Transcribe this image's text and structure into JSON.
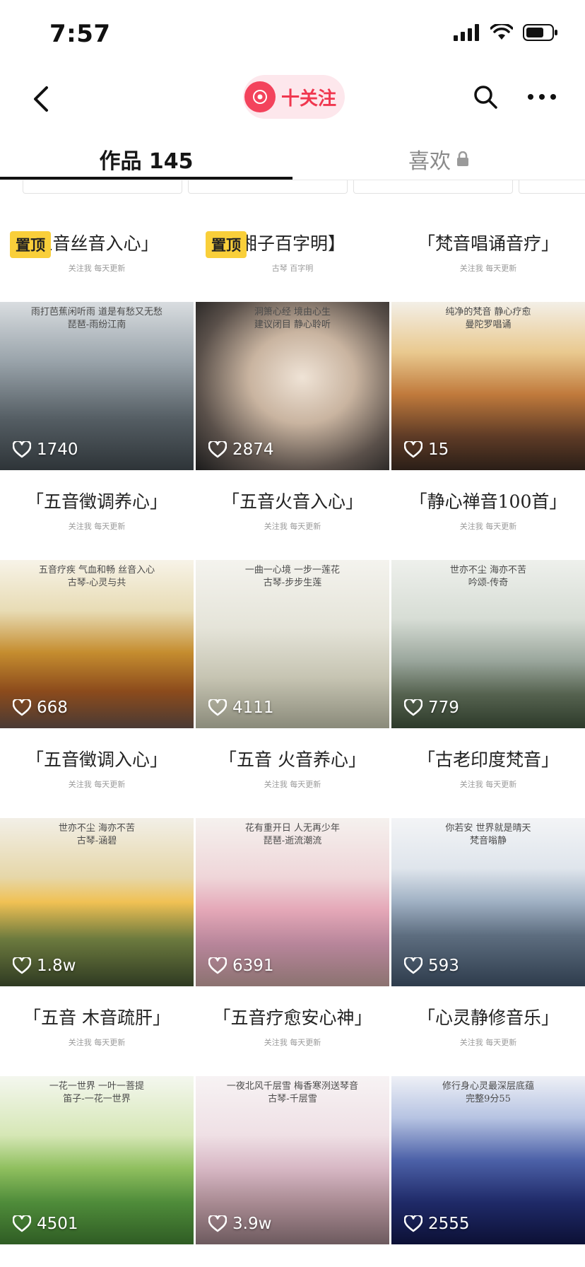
{
  "status_bar": {
    "time": "7:57"
  },
  "nav": {
    "follow_label": "十关注"
  },
  "tabs": [
    {
      "label": "作品 145"
    },
    {
      "label": "喜欢"
    }
  ],
  "pin_label": "置顶",
  "videos": [
    {
      "title": "五音丝音入心」",
      "meta": "关注我 每天更新",
      "caption": "雨打芭蕉闲听雨 道是有愁又无愁\n琵琶-雨纷江南",
      "likes": "1740",
      "pinned": true,
      "scene": "pavilion-rain"
    },
    {
      "title": "湘子百字明】",
      "meta": "古琴 百字明",
      "caption": "洞箫心经 境由心生\n建议闭目 静心聆听",
      "likes": "2874",
      "pinned": true,
      "scene": "singer"
    },
    {
      "title": "「梵音唱诵音疗」",
      "meta": "关注我 每天更新",
      "caption": "纯净的梵音 静心疗愈\n曼陀罗唱诵",
      "likes": "15",
      "pinned": false,
      "scene": "sunset-clouds"
    },
    {
      "title": "「五音徵调养心」",
      "meta": "关注我 每天更新",
      "caption": "五音疗疾 气血和畅 丝音入心\n古琴-心灵与共",
      "likes": "668",
      "pinned": false,
      "scene": "temple"
    },
    {
      "title": "「五音火音入心」",
      "meta": "关注我 每天更新",
      "caption": "一曲一心境 一步一莲花\n古琴-步步生莲",
      "likes": "4111",
      "pinned": false,
      "scene": "lotus-white"
    },
    {
      "title": "「静心禅音100首」",
      "meta": "关注我 每天更新",
      "caption": "世亦不尘 海亦不苦\n吟颂-传奇",
      "likes": "779",
      "pinned": false,
      "scene": "monk-mountain"
    },
    {
      "title": "「五音徵调入心」",
      "meta": "关注我 每天更新",
      "caption": "世亦不尘 海亦不苦\n古琴-涵碧",
      "likes": "1.8w",
      "pinned": false,
      "scene": "forest-sun"
    },
    {
      "title": "「五音 火音养心」",
      "meta": "关注我 每天更新",
      "caption": "花有重开日 人无再少年\n琵琶-逝流潮流",
      "likes": "6391",
      "pinned": false,
      "scene": "cherry"
    },
    {
      "title": "「古老印度梵音」",
      "meta": "关注我 每天更新",
      "caption": "你若安 世界就是晴天\n梵音嗡静",
      "likes": "593",
      "pinned": false,
      "scene": "snow-mountain"
    },
    {
      "title": "「五音 木音疏肝」",
      "meta": "关注我 每天更新",
      "caption": "一花一世界 一叶一菩提\n笛子-一花一世界",
      "likes": "4501",
      "pinned": false,
      "scene": "pink-lotus"
    },
    {
      "title": "「五音疗愈安心神」",
      "meta": "关注我 每天更新",
      "caption": "一夜北风千层雪 梅香寒洌送琴音\n古琴-千层雪",
      "likes": "3.9w",
      "pinned": false,
      "scene": "plum-snow"
    },
    {
      "title": "「心灵静修音乐」",
      "meta": "关注我 每天更新",
      "caption": "修行身心灵最深层底蕴\n完整9分55",
      "likes": "2555",
      "pinned": false,
      "scene": "aurora"
    }
  ]
}
